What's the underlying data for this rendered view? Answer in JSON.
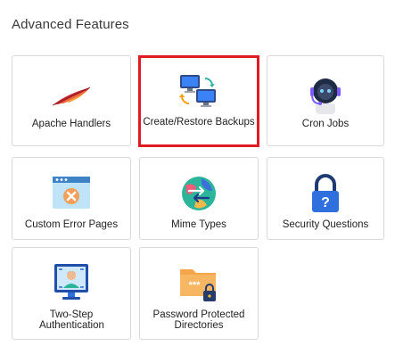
{
  "section": {
    "title": "Advanced Features"
  },
  "features": [
    {
      "label": "Apache Handlers",
      "icon": "feather-icon"
    },
    {
      "label": "Create/Restore Backups",
      "icon": "backup-computers-icon",
      "selected": true
    },
    {
      "label": "Cron Jobs",
      "icon": "robot-icon"
    },
    {
      "label": "Custom Error Pages",
      "icon": "error-window-icon"
    },
    {
      "label": "Mime Types",
      "icon": "globe-arrows-icon"
    },
    {
      "label": "Security Questions",
      "icon": "padlock-question-icon"
    },
    {
      "label": "Two-Step Authentication",
      "icon": "user-scan-icon"
    },
    {
      "label": "Password Protected Directories",
      "icon": "folder-lock-icon"
    }
  ],
  "colors": {
    "selected_outline": "#e01b24",
    "card_border": "#d9d9d9",
    "icon_blue": "#2f6fde"
  }
}
